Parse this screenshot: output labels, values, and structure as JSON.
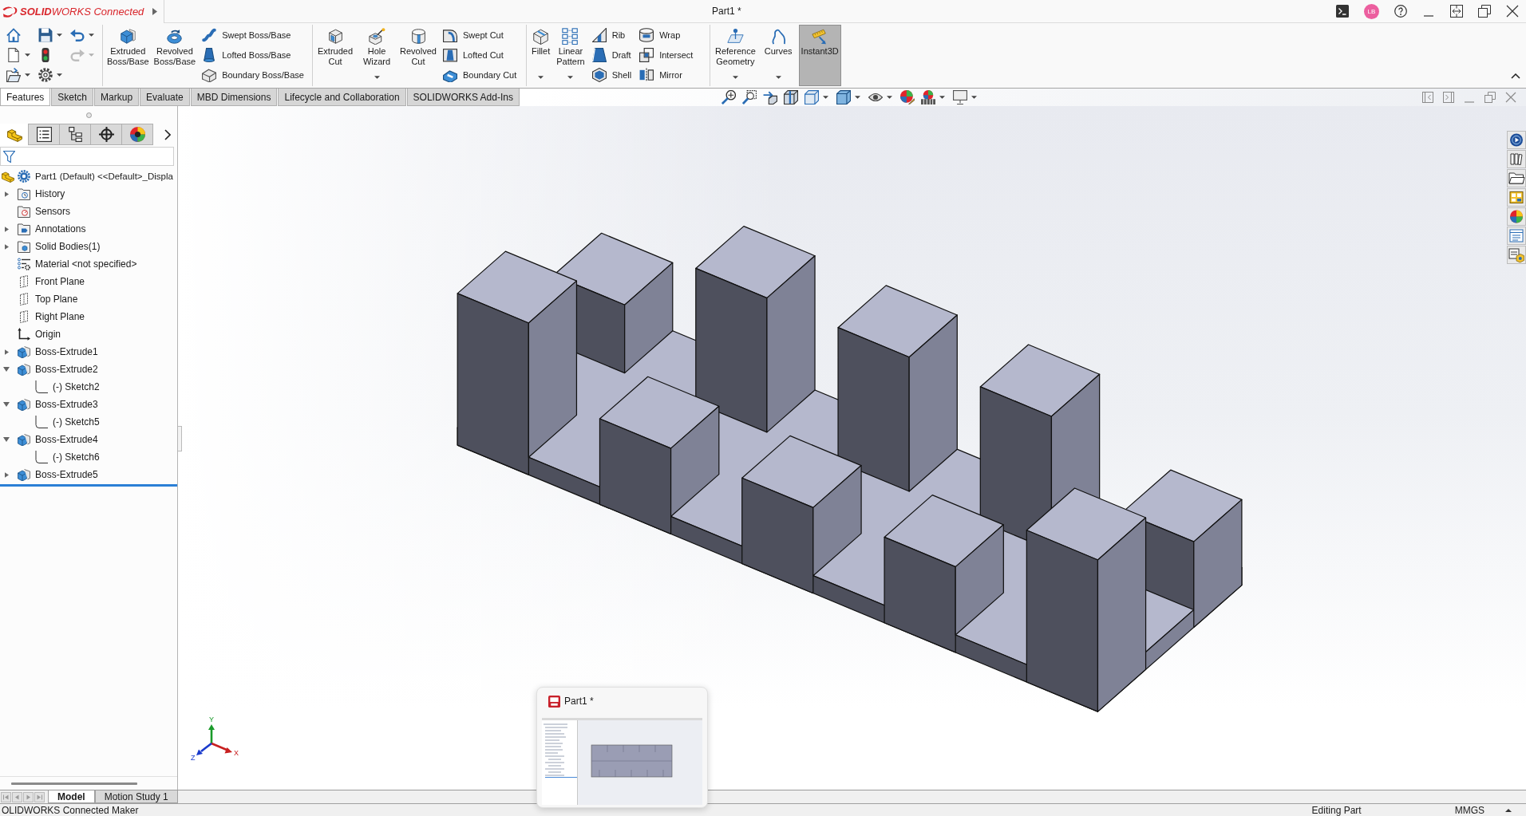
{
  "title_bar": {
    "logo_text": "**SOLID**WORKS Connected",
    "title": "Part1 *",
    "avatar_initials": "LB"
  },
  "quick_access": [
    {
      "dropdown": false,
      "disabled": false
    },
    {
      "dropdown": true,
      "disabled": false
    },
    {
      "dropdown": true,
      "disabled": false
    },
    {
      "dropdown": true,
      "disabled": false
    },
    {
      "dropdown": false,
      "disabled": false
    },
    {
      "dropdown": true,
      "disabled": true
    },
    {
      "dropdown": true,
      "disabled": false
    },
    {
      "dropdown": true,
      "disabled": false
    }
  ],
  "ribbon_groups": [
    {
      "large_buttons": [
        {
          "label": "Extruded Boss/Base",
          "dropdown": false,
          "on": false
        },
        {
          "label": "Revolved Boss/Base",
          "dropdown": false,
          "on": false
        }
      ],
      "small_columns": [
        [
          "Swept Boss/Base",
          "Lofted Boss/Base",
          "Boundary Boss/Base"
        ]
      ]
    },
    {
      "large_buttons": [
        {
          "label": "Extruded Cut",
          "dropdown": false,
          "on": false
        },
        {
          "label": "Hole Wizard",
          "dropdown": true,
          "on": false
        },
        {
          "label": "Revolved Cut",
          "dropdown": false,
          "on": false
        }
      ],
      "small_columns": [
        [
          "Swept Cut",
          "Lofted Cut",
          "Boundary Cut"
        ]
      ]
    },
    {
      "large_buttons": [
        {
          "label": "Fillet",
          "dropdown": true,
          "on": false
        },
        {
          "label": "Linear Pattern",
          "dropdown": true,
          "on": false
        }
      ],
      "small_columns": [
        [
          "Rib",
          "Draft",
          "Shell"
        ],
        [
          "Wrap",
          "Intersect",
          "Mirror"
        ]
      ]
    },
    {
      "large_buttons": [
        {
          "label": "Reference Geometry",
          "dropdown": true,
          "on": false
        },
        {
          "label": "Curves",
          "dropdown": true,
          "on": false
        },
        {
          "label": "Instant3D",
          "dropdown": false,
          "on": true
        }
      ]
    }
  ],
  "command_tabs": [
    {
      "label": "Features",
      "selected": true
    },
    {
      "label": "Sketch",
      "selected": false
    },
    {
      "label": "Markup",
      "selected": false
    },
    {
      "label": "Evaluate",
      "selected": false
    },
    {
      "label": "MBD Dimensions",
      "selected": false
    },
    {
      "label": "Lifecycle and Collaboration",
      "selected": false
    },
    {
      "label": "SOLIDWORKS Add-Ins",
      "selected": false
    }
  ],
  "feature_tree": {
    "panel_tabs": [
      {
        "selected": true
      },
      {
        "selected": false
      },
      {
        "selected": false
      },
      {
        "selected": false
      },
      {
        "selected": false
      }
    ],
    "root": {
      "label": "Part1 (Default) <<Default>_Displa",
      "children": [
        {
          "label": "History",
          "kind": "history",
          "expanded": false
        },
        {
          "label": "Sensors",
          "kind": "sensors"
        },
        {
          "label": "Annotations",
          "kind": "annotations",
          "expanded": false
        },
        {
          "label": "Solid Bodies(1)",
          "kind": "bodies",
          "expanded": false
        },
        {
          "label": "Material <not specified>",
          "kind": "material"
        },
        {
          "label": "Front Plane",
          "kind": "plane"
        },
        {
          "label": "Top Plane",
          "kind": "plane"
        },
        {
          "label": "Right Plane",
          "kind": "plane"
        },
        {
          "label": "Origin",
          "kind": "origin"
        },
        {
          "label": "Boss-Extrude1",
          "kind": "extrude",
          "expanded": false
        },
        {
          "label": "Boss-Extrude2",
          "kind": "extrude",
          "expanded": true,
          "children": [
            {
              "label": "(-) Sketch2",
              "kind": "sketch"
            }
          ]
        },
        {
          "label": "Boss-Extrude3",
          "kind": "extrude",
          "expanded": true,
          "children": [
            {
              "label": "(-) Sketch5",
              "kind": "sketch"
            }
          ]
        },
        {
          "label": "Boss-Extrude4",
          "kind": "extrude",
          "expanded": true,
          "children": [
            {
              "label": "(-) Sketch6",
              "kind": "sketch"
            }
          ]
        },
        {
          "label": "Boss-Extrude5",
          "kind": "extrude",
          "expanded": false
        }
      ]
    }
  },
  "graphics_area": {
    "triad": {
      "x_label": "X",
      "y_label": "Y",
      "z_label": "Z"
    }
  },
  "bottom_tabs": [
    {
      "label": "Model",
      "selected": true
    },
    {
      "label": "Motion Study 1",
      "selected": false
    }
  ],
  "status_bar": {
    "message": "OLIDWORKS Connected Maker",
    "mode": "Editing Part",
    "units": "MMGS"
  },
  "taskbar_preview": {
    "title": "Part1 *"
  }
}
